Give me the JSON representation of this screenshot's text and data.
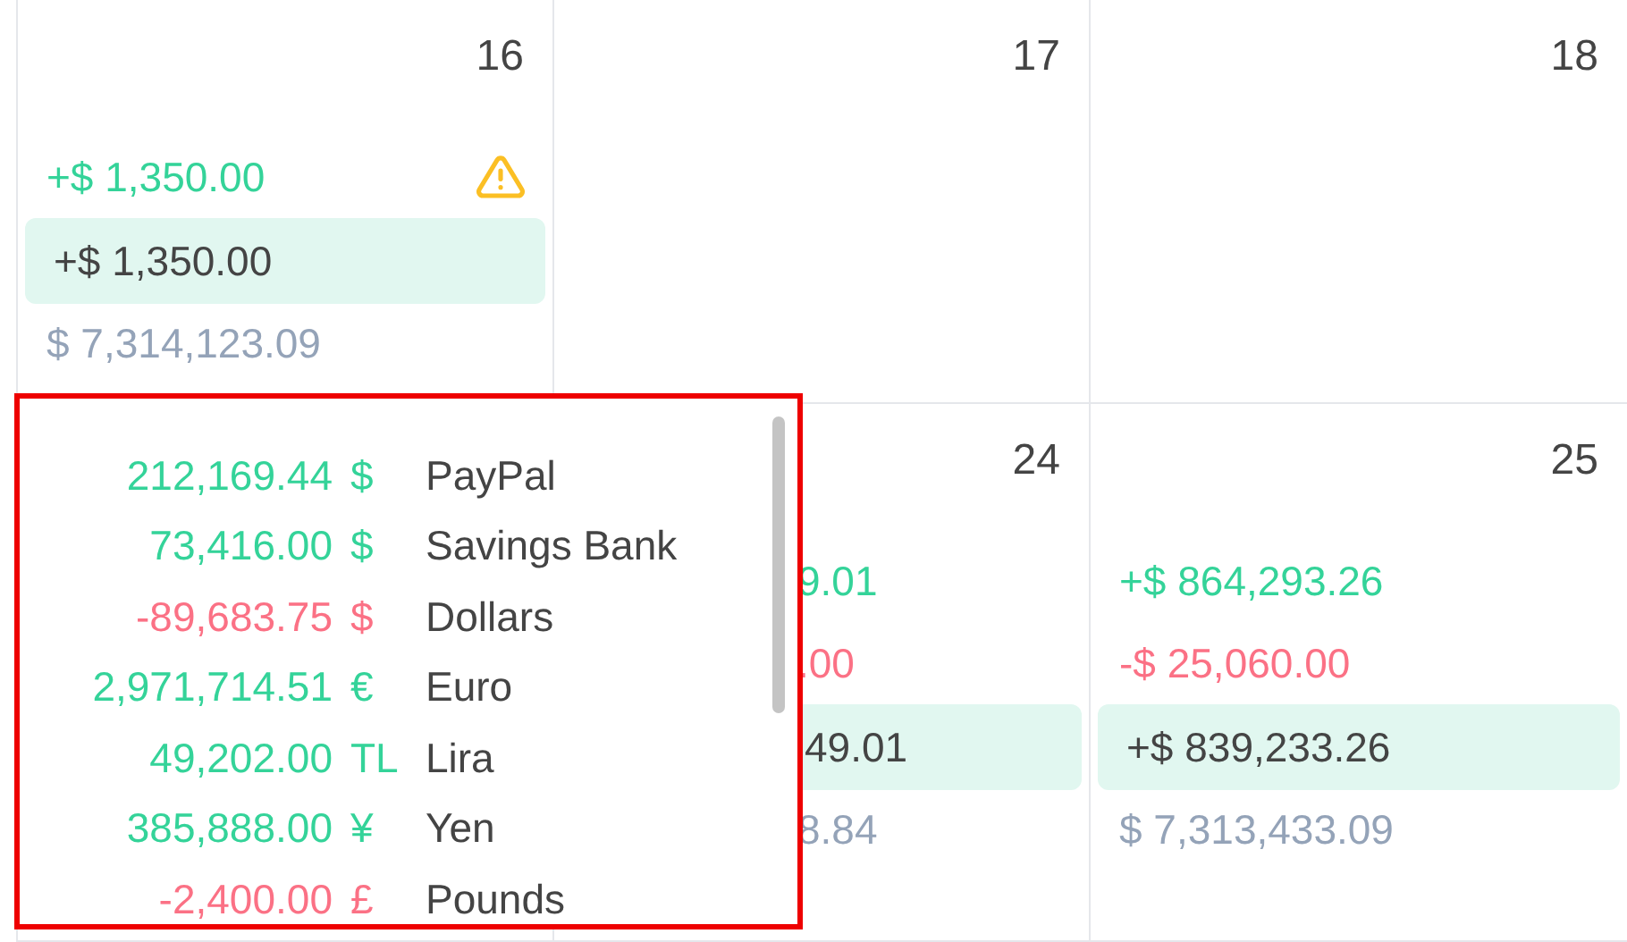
{
  "weeks": [
    {
      "days": [
        {
          "date": "16",
          "entries": [
            {
              "kind": "income",
              "text": "+$ 1,350.00",
              "warning": true
            },
            {
              "kind": "total",
              "text": "+$ 1,350.00"
            },
            {
              "kind": "balance",
              "text": "$ 7,314,123.09"
            }
          ]
        },
        {
          "date": "17"
        },
        {
          "date": "18"
        }
      ]
    },
    {
      "days": [
        {
          "date": "24",
          "entries": [
            {
              "kind": "income",
              "text": "9.01"
            },
            {
              "kind": "expense",
              "text": ".00"
            },
            {
              "kind": "total",
              "text": "49.01"
            },
            {
              "kind": "balance",
              "text": "8.84"
            }
          ]
        },
        {
          "date": "25",
          "entries": [
            {
              "kind": "income",
              "text": "+$ 864,293.26"
            },
            {
              "kind": "expense",
              "text": "-$ 25,060.00"
            },
            {
              "kind": "total",
              "text": "+$ 839,233.26"
            },
            {
              "kind": "balance",
              "text": "$ 7,313,433.09"
            }
          ]
        }
      ]
    }
  ],
  "accounts_popup": {
    "accounts": [
      {
        "amount": "212,169.44",
        "currency": "$",
        "name": "PayPal",
        "negative": false
      },
      {
        "amount": "73,416.00",
        "currency": "$",
        "name": "Savings Bank",
        "negative": false
      },
      {
        "amount": "-89,683.75",
        "currency": "$",
        "name": "Dollars",
        "negative": true
      },
      {
        "amount": "2,971,714.51",
        "currency": "€",
        "name": "Euro",
        "negative": false
      },
      {
        "amount": "49,202.00",
        "currency": "TL",
        "name": "Lira",
        "negative": false
      },
      {
        "amount": "385,888.00",
        "currency": "¥",
        "name": "Yen",
        "negative": false
      },
      {
        "amount": "-2,400.00",
        "currency": "£",
        "name": "Pounds",
        "negative": true
      }
    ]
  }
}
